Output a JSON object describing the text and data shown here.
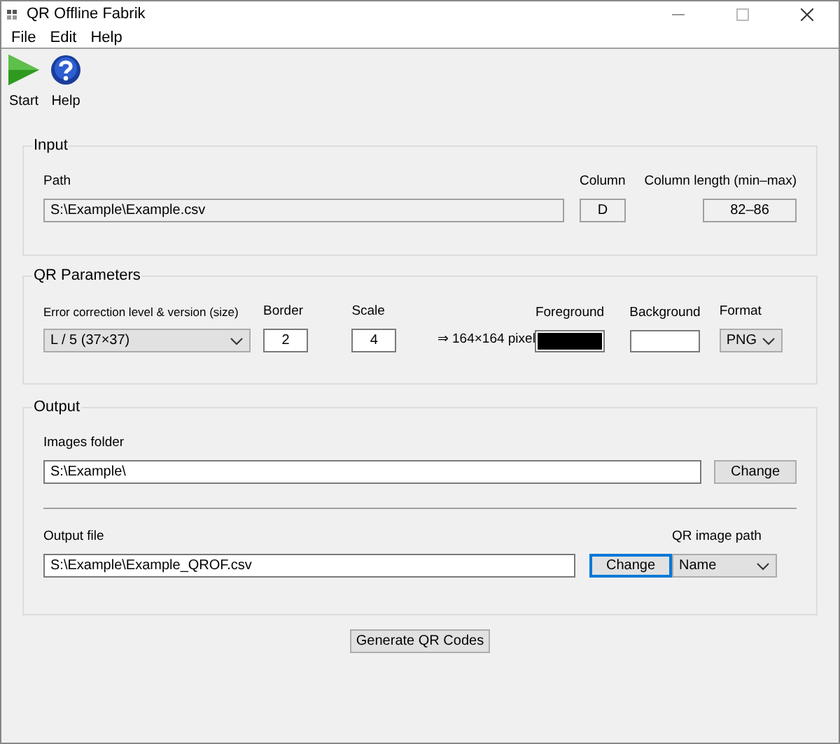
{
  "window": {
    "title": "QR Offline Fabrik"
  },
  "menu": [
    "File",
    "Edit",
    "Help"
  ],
  "toolbar": [
    {
      "label": "Start",
      "kind": "start"
    },
    {
      "label": "Help",
      "kind": "help"
    }
  ],
  "input": {
    "title": "Input",
    "path": {
      "label": "Path",
      "value": "S:\\Example\\Example.csv"
    },
    "column": {
      "label": "Column",
      "value": "D"
    },
    "column_length": {
      "label": "Column length (min–max)",
      "value": "82–86"
    }
  },
  "qr_parameters": {
    "title": "QR Parameters",
    "error_correction": {
      "label": "Error correction level & version (size)",
      "value": "L / 5 (37×37)"
    },
    "border": {
      "label": "Border",
      "value": "2"
    },
    "scale": {
      "label": "Scale",
      "value": "4"
    },
    "result": "⇒ 164×164 pixel",
    "foreground": {
      "label": "Foreground",
      "color": "#000000"
    },
    "background": {
      "label": "Background",
      "color": "#ffffff"
    },
    "format": {
      "label": "Format",
      "value": "PNG"
    }
  },
  "output": {
    "title": "Output",
    "images_folder": {
      "label": "Images folder",
      "value": "S:\\Example\\",
      "button": {
        "label": "Change",
        "focused": false
      }
    },
    "output_file": {
      "label": "Output file",
      "value": "S:\\Example\\Example_QROF.csv",
      "button": {
        "label": "Change",
        "focused": true
      }
    },
    "qr_image_path": {
      "label": "QR image path",
      "value": "Name"
    }
  },
  "generate_button": "Generate QR Codes"
}
